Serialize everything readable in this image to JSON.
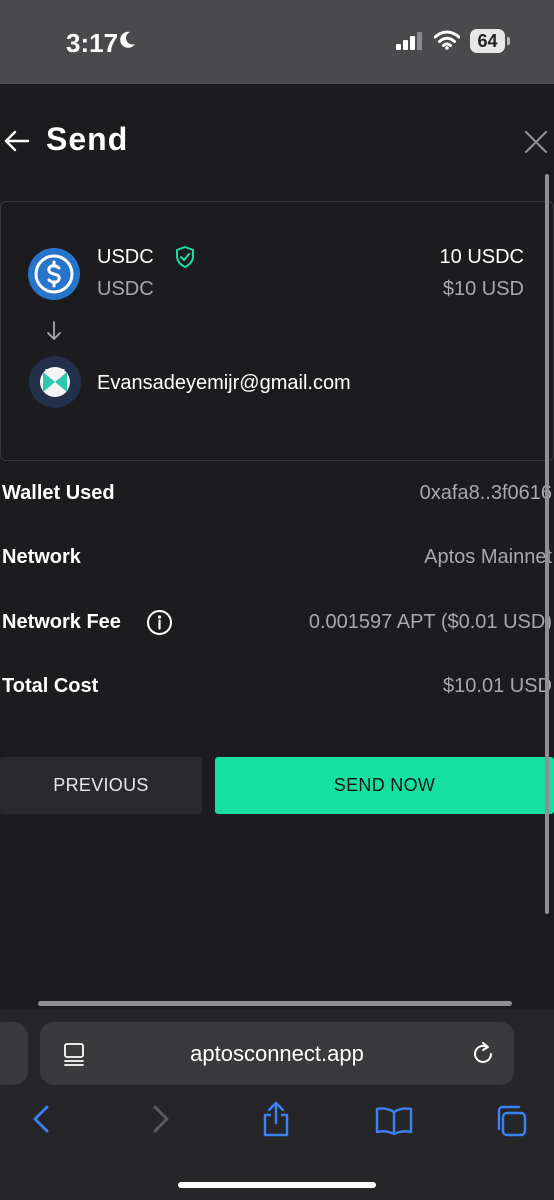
{
  "status_bar": {
    "time": "3:17",
    "battery": "64"
  },
  "header": {
    "title": "Send"
  },
  "token": {
    "name": "USDC",
    "symbol": "USDC",
    "amount": "10 USDC",
    "amount_usd": "$10 USD",
    "brand_color": "#2775ca",
    "verified_color": "#16e0a0"
  },
  "recipient": {
    "email": "Evansadeyemijr@gmail.com"
  },
  "details": {
    "wallet_label": "Wallet Used",
    "wallet_value": "0xafa8..3f0616",
    "network_label": "Network",
    "network_value": "Aptos Mainnet",
    "fee_label": "Network Fee",
    "fee_value": "0.001597 APT ($0.01 USD)",
    "total_label": "Total Cost",
    "total_value": "$10.01 USD"
  },
  "buttons": {
    "previous": "PREVIOUS",
    "send_now": "SEND NOW",
    "accent_color": "#16e0a0"
  },
  "browser": {
    "url": "aptosconnect.app",
    "link_color": "#3b82f6"
  }
}
